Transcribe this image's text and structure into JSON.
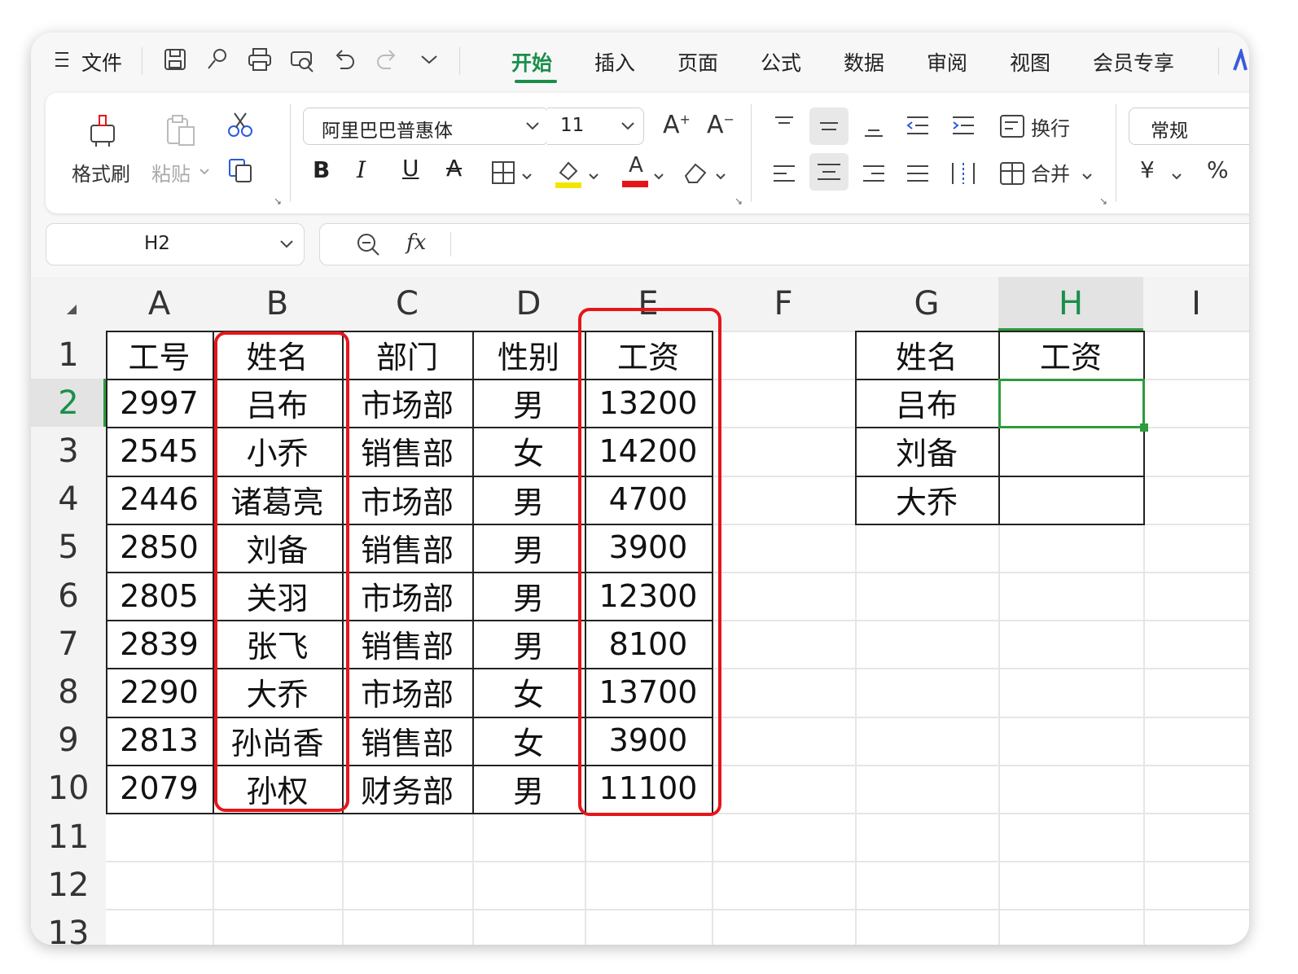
{
  "menu": {
    "hamburger_icon": "hamburger-icon",
    "file_label": "文件",
    "tabs": [
      "开始",
      "插入",
      "页面",
      "公式",
      "数据",
      "审阅",
      "视图",
      "会员专享"
    ],
    "active_tab": "开始"
  },
  "ribbon": {
    "format_painter": "格式刷",
    "paste": "粘贴",
    "font_name": "阿里巴巴普惠体",
    "font_size": "11",
    "bold": "B",
    "italic": "I",
    "underline": "U",
    "strike": "A",
    "grow_font": "A",
    "shrink_font": "A",
    "font_color_letter": "A",
    "wrap": "换行",
    "merge": "合并",
    "number_format": "常规",
    "currency": "¥",
    "percent": "%",
    "comma": "%"
  },
  "formula_bar": {
    "name_box": "H2",
    "fx": "fx",
    "value": ""
  },
  "sheet": {
    "columns": [
      "A",
      "B",
      "C",
      "D",
      "E",
      "F",
      "G",
      "H",
      "I"
    ],
    "rows": [
      "1",
      "2",
      "3",
      "4",
      "5",
      "6",
      "7",
      "8",
      "9",
      "10",
      "11",
      "12",
      "13"
    ],
    "selected_cell": "H2",
    "table_header": [
      "工号",
      "姓名",
      "部门",
      "性别",
      "工资"
    ],
    "table_rows": [
      [
        "2997",
        "吕布",
        "市场部",
        "男",
        "13200"
      ],
      [
        "2545",
        "小乔",
        "销售部",
        "女",
        "14200"
      ],
      [
        "2446",
        "诸葛亮",
        "市场部",
        "男",
        "4700"
      ],
      [
        "2850",
        "刘备",
        "销售部",
        "男",
        "3900"
      ],
      [
        "2805",
        "关羽",
        "市场部",
        "男",
        "12300"
      ],
      [
        "2839",
        "张飞",
        "销售部",
        "男",
        "8100"
      ],
      [
        "2290",
        "大乔",
        "市场部",
        "女",
        "13700"
      ],
      [
        "2813",
        "孙尚香",
        "销售部",
        "女",
        "3900"
      ],
      [
        "2079",
        "孙权",
        "财务部",
        "男",
        "11100"
      ]
    ],
    "lookup_header": [
      "姓名",
      "工资"
    ],
    "lookup_rows": [
      [
        "吕布",
        ""
      ],
      [
        "刘备",
        ""
      ],
      [
        "大乔",
        ""
      ]
    ]
  },
  "colors": {
    "accent": "#1a8f4a",
    "highlight": "#e5161b",
    "selection": "#2e9b3c"
  }
}
